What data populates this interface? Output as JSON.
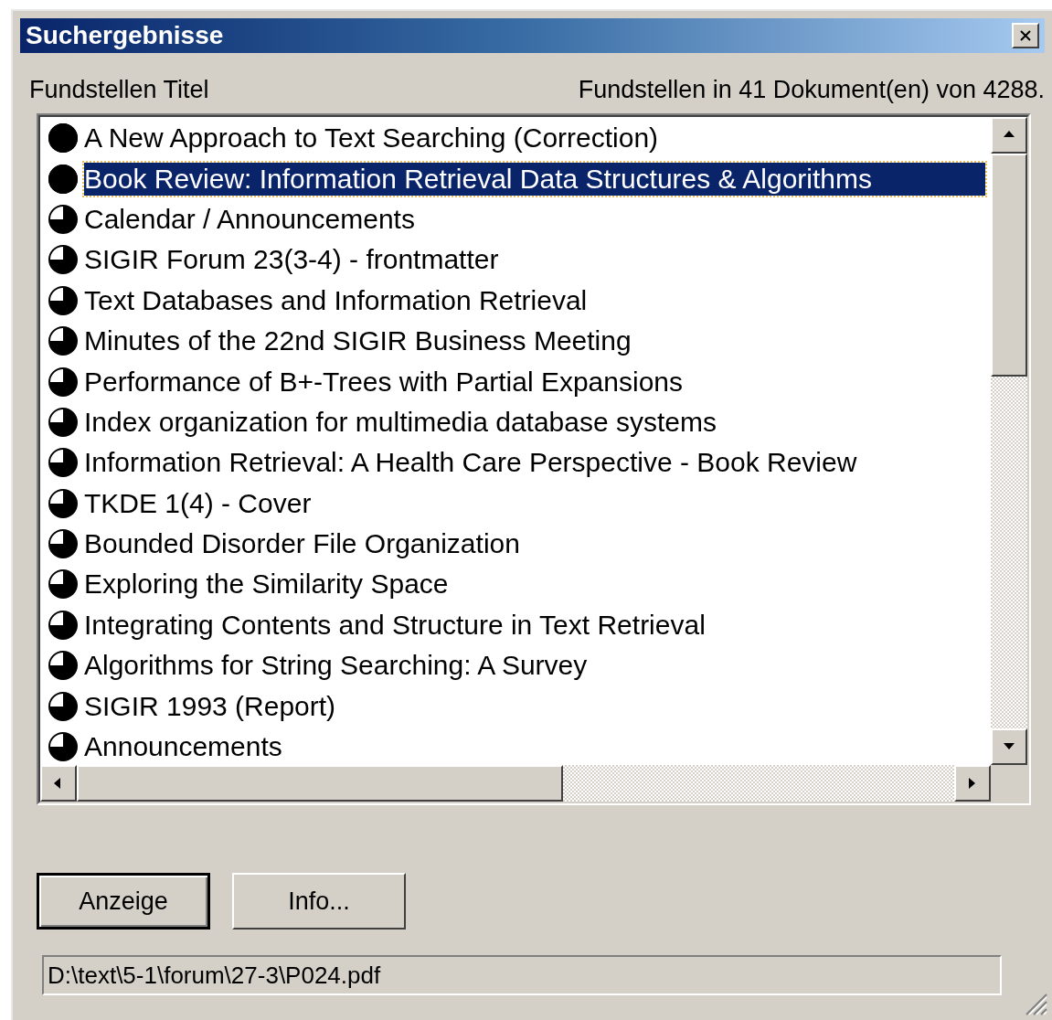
{
  "window": {
    "title": "Suchergebnisse"
  },
  "header": {
    "left": "Fundstellen Titel",
    "right": "Fundstellen in 41 Dokument(en) von 4288."
  },
  "results": [
    {
      "title": "A New Approach to Text Searching (Correction)",
      "kind": "full",
      "selected": false
    },
    {
      "title": "Book Review: Information Retrieval Data Structures & Algorithms",
      "kind": "full",
      "selected": true
    },
    {
      "title": "Calendar / Announcements",
      "kind": "three-quarter",
      "selected": false
    },
    {
      "title": "SIGIR Forum 23(3-4) - frontmatter",
      "kind": "three-quarter",
      "selected": false
    },
    {
      "title": "Text Databases and Information Retrieval",
      "kind": "three-quarter",
      "selected": false
    },
    {
      "title": "Minutes of the 22nd SIGIR Business Meeting",
      "kind": "three-quarter",
      "selected": false
    },
    {
      "title": "Performance of B+-Trees with Partial Expansions",
      "kind": "three-quarter",
      "selected": false
    },
    {
      "title": "Index organization for multimedia database systems",
      "kind": "three-quarter",
      "selected": false
    },
    {
      "title": "Information Retrieval: A Health Care Perspective - Book Review",
      "kind": "three-quarter",
      "selected": false
    },
    {
      "title": "TKDE 1(4) - Cover",
      "kind": "three-quarter",
      "selected": false
    },
    {
      "title": "Bounded Disorder File Organization",
      "kind": "three-quarter",
      "selected": false
    },
    {
      "title": "Exploring the Similarity Space",
      "kind": "three-quarter",
      "selected": false
    },
    {
      "title": "Integrating Contents and Structure in Text Retrieval",
      "kind": "three-quarter",
      "selected": false
    },
    {
      "title": "Algorithms for String Searching: A Survey",
      "kind": "three-quarter",
      "selected": false
    },
    {
      "title": "SIGIR 1993 (Report)",
      "kind": "three-quarter",
      "selected": false
    },
    {
      "title": "Announcements",
      "kind": "three-quarter",
      "selected": false
    }
  ],
  "buttons": [
    {
      "label": "Anzeige",
      "default": true
    },
    {
      "label": "Info...",
      "default": false
    }
  ],
  "path": "D:\\text\\5-1\\forum\\27-3\\P024.pdf"
}
